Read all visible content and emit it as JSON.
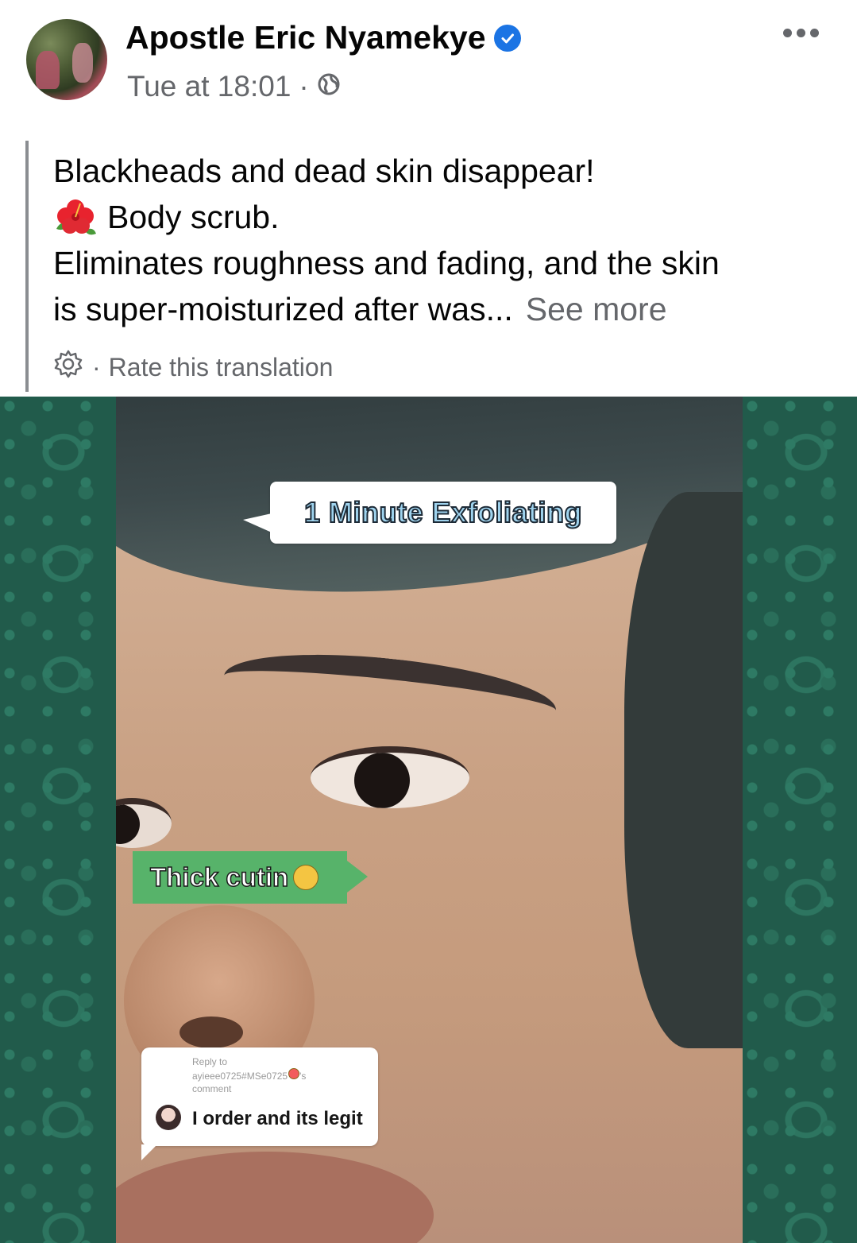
{
  "post": {
    "author": "Apostle Eric Nyamekye",
    "timestamp": "Tue at 18:01",
    "separator": "·",
    "audience_icon": "globe-icon",
    "verified_icon": "verified-badge-icon",
    "more_icon": "more-options-icon",
    "text": {
      "line1": "Blackheads and dead skin disappear!",
      "line2": "Body scrub.",
      "line3": "Eliminates roughness and fading, and the skin",
      "line4": "is super-moisturized after was...",
      "see_more": "See more"
    },
    "translation": {
      "separator": "·",
      "label": "Rate this translation"
    }
  },
  "video": {
    "overlay_top": "1 Minute Exfoliating",
    "overlay_middle": "Thick cutin",
    "reply": {
      "line1": "Reply to",
      "line2": "ayieee0725#MSe0725",
      "line3": "'s",
      "line4": "comment",
      "comment": "I order and its legit"
    }
  },
  "colors": {
    "accent": "#1b74e4",
    "secondary_text": "#65676b",
    "pattern_green": "#215b4b",
    "overlay_green": "#57b36a"
  }
}
